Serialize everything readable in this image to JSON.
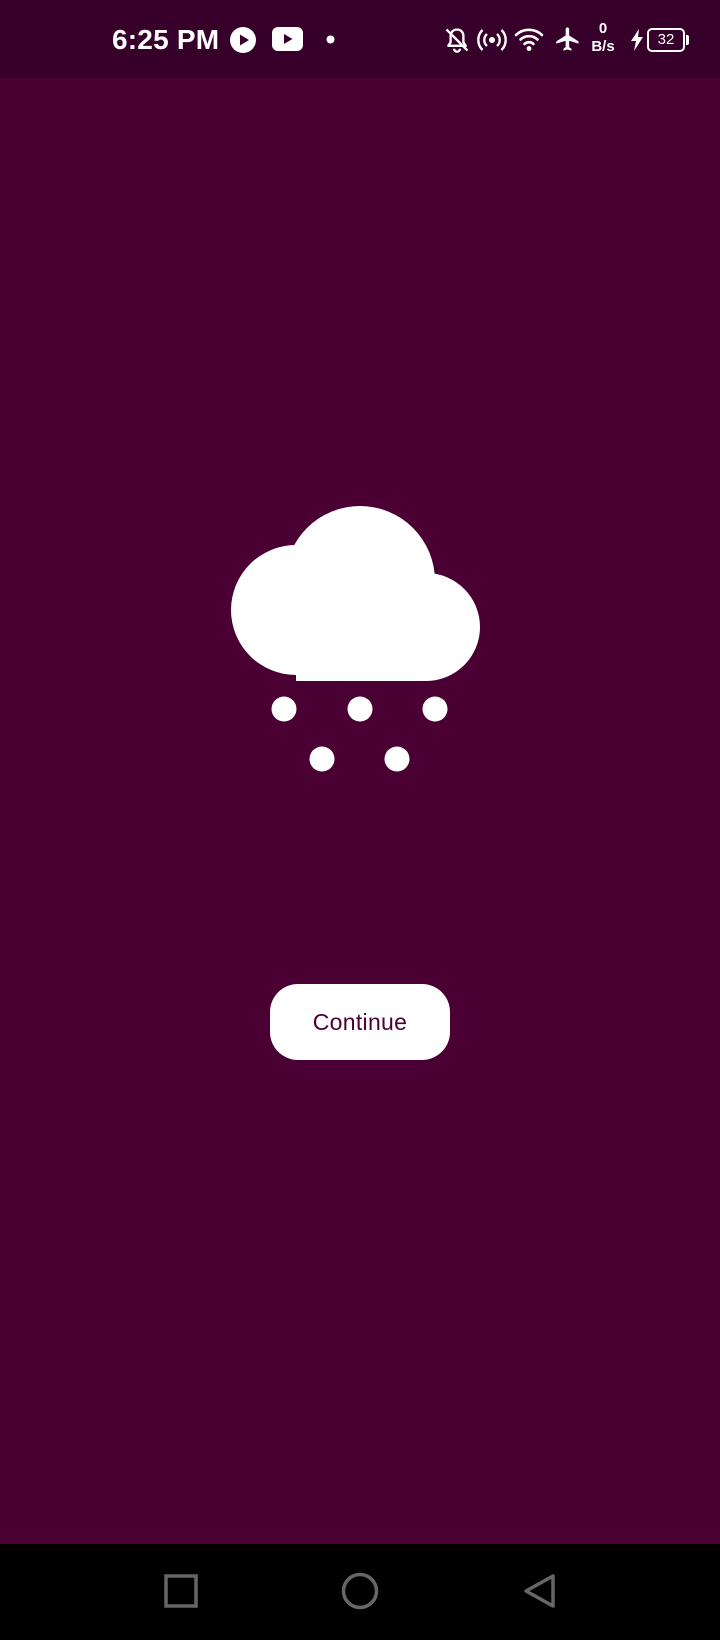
{
  "status_bar": {
    "time": "6:25 PM",
    "net_speed_value": "0",
    "net_speed_unit": "B/s",
    "battery_level": "32",
    "icons": [
      "play-icon",
      "youtube-icon",
      "notification-dot-icon",
      "bell-off-icon",
      "hotspot-icon",
      "wifi-icon",
      "airplane-icon",
      "charging-bolt-icon",
      "battery-icon"
    ]
  },
  "main": {
    "weather_icon": "snow-cloud-icon",
    "continue_label": "Continue"
  },
  "navigation_bar": {
    "buttons": [
      "recents-button",
      "home-button",
      "back-button"
    ]
  },
  "colors": {
    "background": "#4a0033",
    "status_bar": "#37002a",
    "foreground": "#ffffff",
    "nav_bar": "#000000"
  }
}
